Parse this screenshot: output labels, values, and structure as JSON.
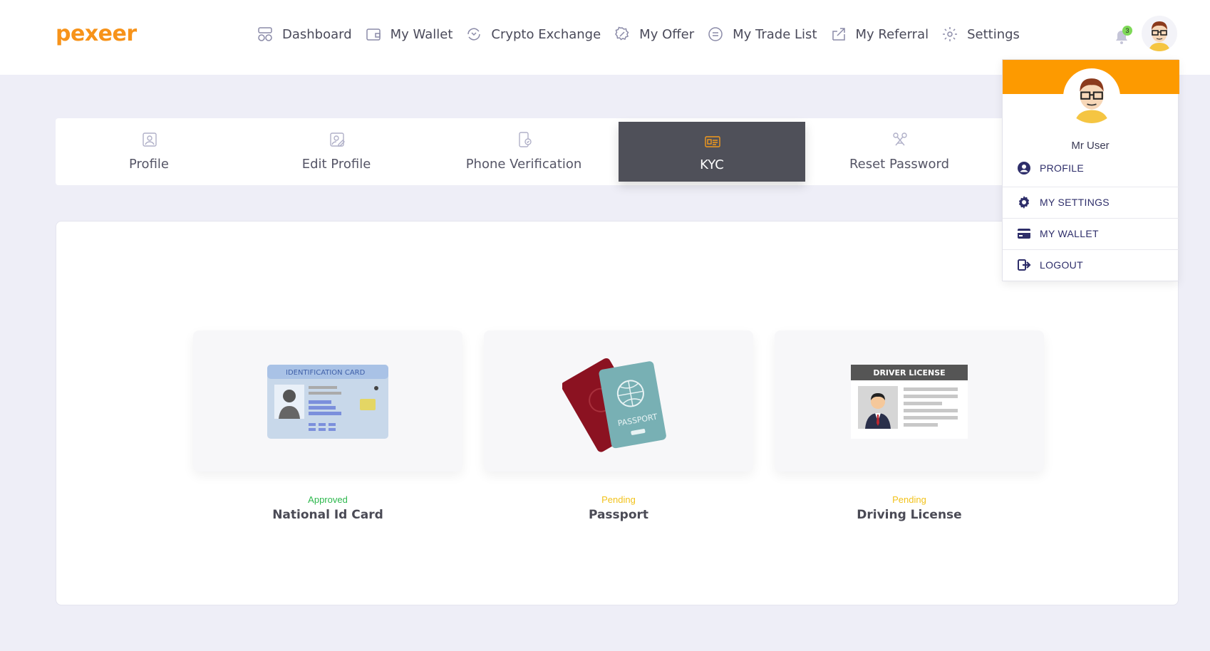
{
  "brand": {
    "logo_text": "pexeer",
    "accent": "#f7931a"
  },
  "nav": {
    "items": [
      {
        "label": "Dashboard",
        "icon": "dashboard-icon"
      },
      {
        "label": "My Wallet",
        "icon": "wallet-icon"
      },
      {
        "label": "Crypto Exchange",
        "icon": "exchange-icon"
      },
      {
        "label": "My Offer",
        "icon": "offer-icon"
      },
      {
        "label": "My Trade List",
        "icon": "trade-list-icon"
      },
      {
        "label": "My Referral",
        "icon": "referral-icon"
      },
      {
        "label": "Settings",
        "icon": "gear-icon"
      }
    ]
  },
  "notifications": {
    "count": "3"
  },
  "tabs": [
    {
      "label": "Profile",
      "icon": "profile-icon"
    },
    {
      "label": "Edit Profile",
      "icon": "edit-profile-icon"
    },
    {
      "label": "Phone Verification",
      "icon": "phone-verification-icon"
    },
    {
      "label": "KYC",
      "icon": "id-card-icon",
      "active": true
    },
    {
      "label": "Reset Password",
      "icon": "reset-password-icon"
    }
  ],
  "documents": [
    {
      "status": "Approved",
      "status_color": "#2db84d",
      "name": "National Id Card",
      "card_title": "IDENTIFICATION CARD"
    },
    {
      "status": "Pending",
      "status_color": "#f2c21b",
      "name": "Passport",
      "card_title": "PASSPORT"
    },
    {
      "status": "Pending",
      "status_color": "#f2c21b",
      "name": "Driving License",
      "card_title": "DRIVER LICENSE"
    }
  ],
  "user_menu": {
    "name": "Mr User",
    "items": [
      {
        "label": "PROFILE",
        "icon": "user-circle-icon"
      },
      {
        "label": "MY SETTINGS",
        "icon": "cog-icon"
      },
      {
        "label": "MY WALLET",
        "icon": "credit-card-icon"
      },
      {
        "label": "LOGOUT",
        "icon": "logout-icon"
      }
    ],
    "header_color": "#fd9a00"
  }
}
